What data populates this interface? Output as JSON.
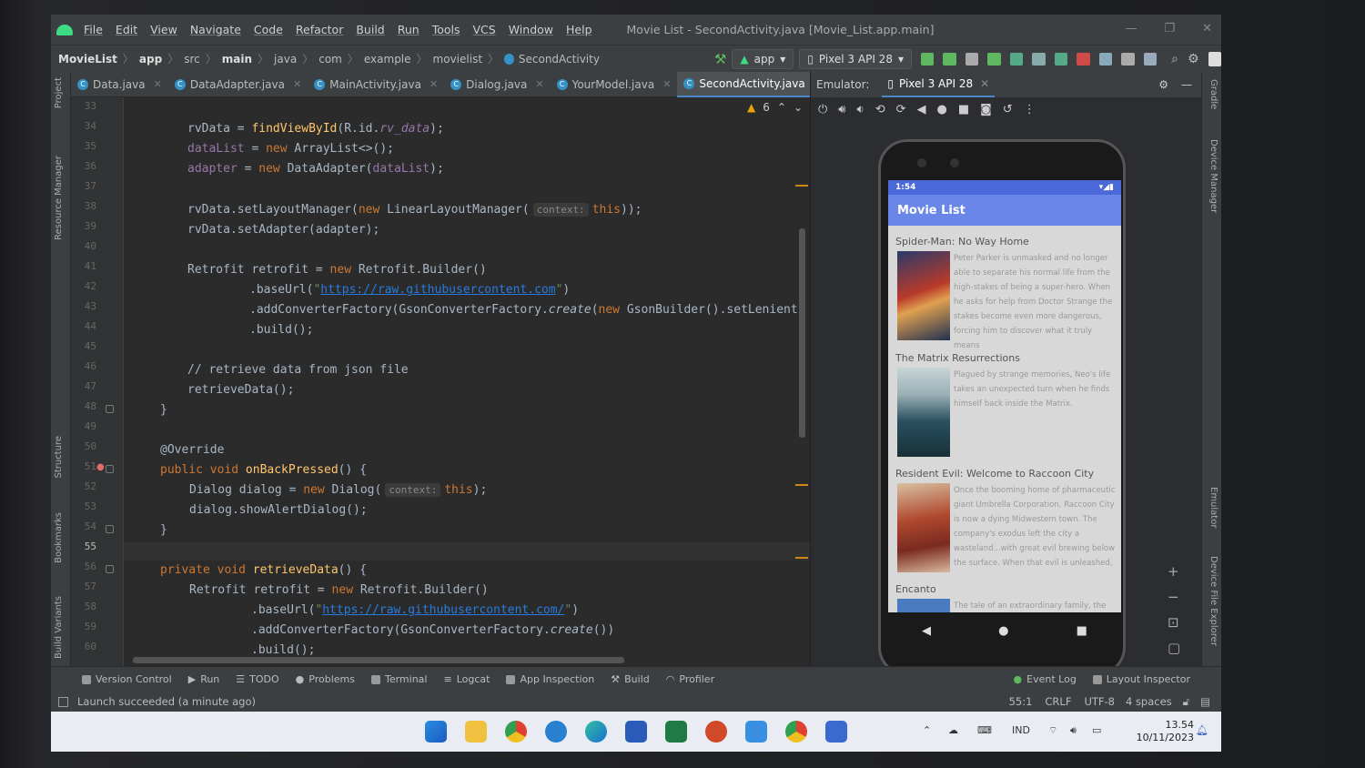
{
  "window": {
    "title": "Movie List - SecondActivity.java [Movie_List.app.main]"
  },
  "menu": [
    "File",
    "Edit",
    "View",
    "Navigate",
    "Code",
    "Refactor",
    "Build",
    "Run",
    "Tools",
    "VCS",
    "Window",
    "Help"
  ],
  "breadcrumb": [
    "MovieList",
    "app",
    "src",
    "main",
    "java",
    "com",
    "example",
    "movielist",
    "SecondActivity"
  ],
  "run_config": "app",
  "device": "Pixel 3 API 28",
  "tabs": [
    "Data.java",
    "DataAdapter.java",
    "MainActivity.java",
    "Dialog.java",
    "YourModel.java",
    "SecondActivity.java"
  ],
  "warnings": "6",
  "line_numbers": [
    "33",
    "34",
    "35",
    "36",
    "37",
    "38",
    "39",
    "40",
    "41",
    "42",
    "43",
    "44",
    "45",
    "46",
    "47",
    "48",
    "49",
    "50",
    "51",
    "52",
    "53",
    "54",
    "55",
    "56",
    "57",
    "58",
    "59",
    "60"
  ],
  "code": {
    "l34a": "rvData = ",
    "l34b": "findViewById",
    "l34c": "(R.id.",
    "l34d": "rv_data",
    "l34e": ");",
    "l35a": "dataList",
    "l35b": " = ",
    "l35c": "new ",
    "l35d": "ArrayList<>();",
    "l36a": "adapter",
    "l36b": " = ",
    "l36c": "new ",
    "l36d": "DataAdapter(",
    "l36e": "dataList",
    "l36f": ");",
    "l38a": "rvData.setLayoutManager(",
    "l38b": "new ",
    "l38c": "LinearLayoutManager(",
    "l38h": "context:",
    "l38d": "this",
    "l38e": "));",
    "l39": "rvData.setAdapter(adapter);",
    "l41a": "Retrofit retrofit = ",
    "l41b": "new ",
    "l41c": "Retrofit.Builder()",
    "l42a": ".baseUrl(",
    "l42q1": "\"",
    "l42b": "https://raw.githubusercontent.com",
    "l42q2": "\"",
    "l42c": ")",
    "l43a": ".addConverterFactory(GsonConverterFactory.",
    "l43b": "create",
    "l43c": "(",
    "l43d": "new ",
    "l43e": "GsonBuilder().setLenient",
    "l44": ".build();",
    "l46": "// retrieve data from json file",
    "l47": "retrieveData();",
    "l48": "}",
    "l50": "@Override",
    "l51a": "public void ",
    "l51b": "onBackPressed",
    "l51c": "() {",
    "l52a": "Dialog dialog = ",
    "l52b": "new ",
    "l52c": "Dialog(",
    "l52h": "context:",
    "l52d": "this",
    "l52e": ");",
    "l53": "dialog.showAlertDialog();",
    "l54": "}",
    "l56a": "private void ",
    "l56b": "retrieveData",
    "l56c": "() {",
    "l57a": "Retrofit retrofit = ",
    "l57b": "new ",
    "l57c": "Retrofit.Builder()",
    "l58a": ".baseUrl(",
    "l58q1": "\"",
    "l58b": "https://raw.githubusercontent.com/",
    "l58q2": "\"",
    "l58c": ")",
    "l59a": ".addConverterFactory(GsonConverterFactory.",
    "l59b": "create",
    "l59c": "())",
    "l60": ".build();"
  },
  "emulator": {
    "label": "Emulator:",
    "tab": "Pixel 3 API 28"
  },
  "phone": {
    "time": "1:54",
    "app_title": "Movie List",
    "movies": [
      {
        "title": "Spider-Man: No Way Home",
        "desc": "Peter Parker is unmasked and no longer able to separate his normal life from the high-stakes of being a super-hero. When he asks for help from Doctor Strange the stakes become even more dangerous, forcing him to discover what it truly means"
      },
      {
        "title": "The Matrix Resurrections",
        "desc": "Plagued by strange memories, Neo's life takes an unexpected turn when he finds himself back inside the Matrix."
      },
      {
        "title": "Resident Evil: Welcome to Raccoon City",
        "desc": "Once the booming home of pharmaceutic giant Umbrella Corporation, Raccoon City is now a dying Midwestern town. The company's exodus left the city a wasteland...with great evil brewing below the surface. When that evil is unleashed,"
      },
      {
        "title": "Encanto",
        "desc": "The tale of an extraordinary family, the"
      }
    ]
  },
  "left_tools": [
    "Project",
    "Resource Manager",
    "Structure",
    "Bookmarks",
    "Build Variants"
  ],
  "right_tools": [
    "Gradle",
    "Device Manager",
    "Emulator",
    "Device File Explorer"
  ],
  "tool_windows": [
    "Version Control",
    "Run",
    "TODO",
    "Problems",
    "Terminal",
    "Logcat",
    "App Inspection",
    "Build",
    "Profiler"
  ],
  "tool_windows_right": [
    "Event Log",
    "Layout Inspector"
  ],
  "status": {
    "message": "Launch succeeded (a minute ago)",
    "position": "55:1",
    "line_sep": "CRLF",
    "encoding": "UTF-8",
    "indent": "4 spaces"
  },
  "taskbar": {
    "lang": "IND",
    "time": "13.54",
    "date": "10/11/2023"
  },
  "colors": {
    "accent": "#4a88c7",
    "app_bar": "#6a86e8",
    "status_bar": "#4a68d8"
  }
}
